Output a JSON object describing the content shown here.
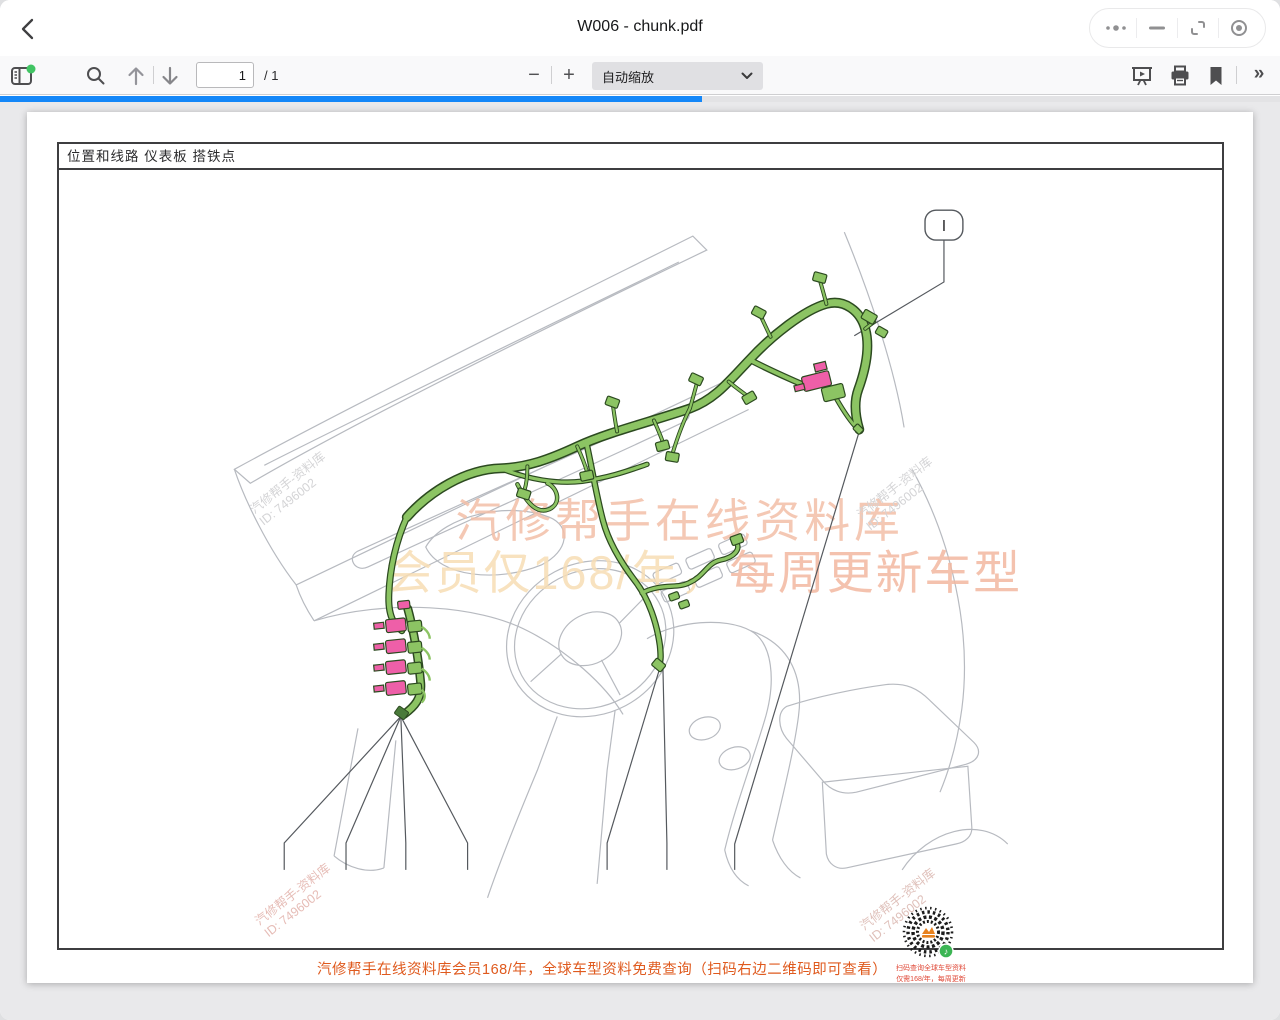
{
  "titlebar": {
    "title": "W006 - chunk.pdf"
  },
  "toolbar": {
    "page_input": "1",
    "page_total": "/ 1",
    "zoom_out": "−",
    "zoom_in": "+",
    "zoom_select": "自动缩放",
    "more_tools": "»"
  },
  "page": {
    "header_tabs": "位置和线路 仪表板 搭铁点",
    "callout_label": "I",
    "watermark_line1": "汽修帮手在线资料库",
    "watermark_line2a": "会员仅168/年，",
    "watermark_line2b": "每周更新车型",
    "diag_wm_line1": "汽修帮手-资料库",
    "diag_wm_line2": "ID: 7496002",
    "qr_caption1": "扫码查询全球车型资料",
    "qr_caption2": "仅需168/年，每周更新",
    "footer_note": "汽修帮手在线资料库会员168/年，全球车型资料免费查询（扫码右边二维码即可查看）"
  },
  "colors": {
    "harness_green": "#8cc463",
    "connector_pink": "#ee5fa8",
    "progress_blue": "#1487f8",
    "footer_orange": "#df5a1e",
    "sidebar_dot_green": "#41c463"
  }
}
